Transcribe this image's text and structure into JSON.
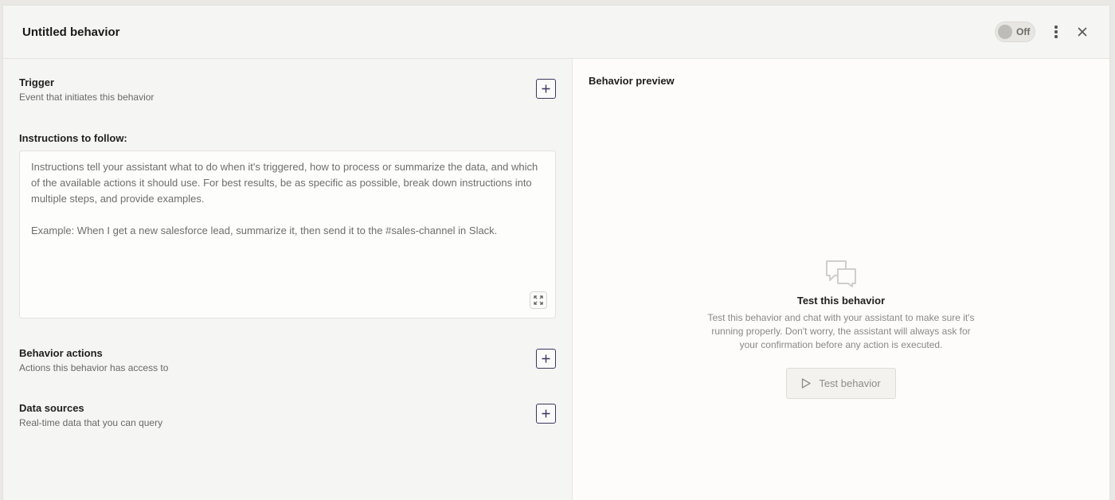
{
  "header": {
    "title": "Untitled behavior",
    "toggle_label": "Off"
  },
  "trigger": {
    "title": "Trigger",
    "subtitle": "Event that initiates this behavior"
  },
  "instructions": {
    "label": "Instructions to follow:",
    "placeholder": "Instructions tell your assistant what to do when it's triggered, how to process or summarize the data, and which of the available actions it should use. For best results, be as specific as possible, break down instructions into multiple steps, and provide examples.\n\nExample: When I get a new salesforce lead, summarize it, then send it to the #sales-channel in Slack."
  },
  "behavior_actions": {
    "title": "Behavior actions",
    "subtitle": "Actions this behavior has access to"
  },
  "data_sources": {
    "title": "Data sources",
    "subtitle": "Real-time data that you can query"
  },
  "preview": {
    "title": "Behavior preview",
    "empty_title": "Test this behavior",
    "empty_description": "Test this behavior and chat with your assistant to make sure it's running properly. Don't worry, the assistant will always ask for your confirmation before any action is executed.",
    "test_button_label": "Test behavior"
  },
  "colors": {
    "accent_border": "#3b3761",
    "panel_bg": "#f5f5f3",
    "preview_bg": "#fdfcfa"
  }
}
